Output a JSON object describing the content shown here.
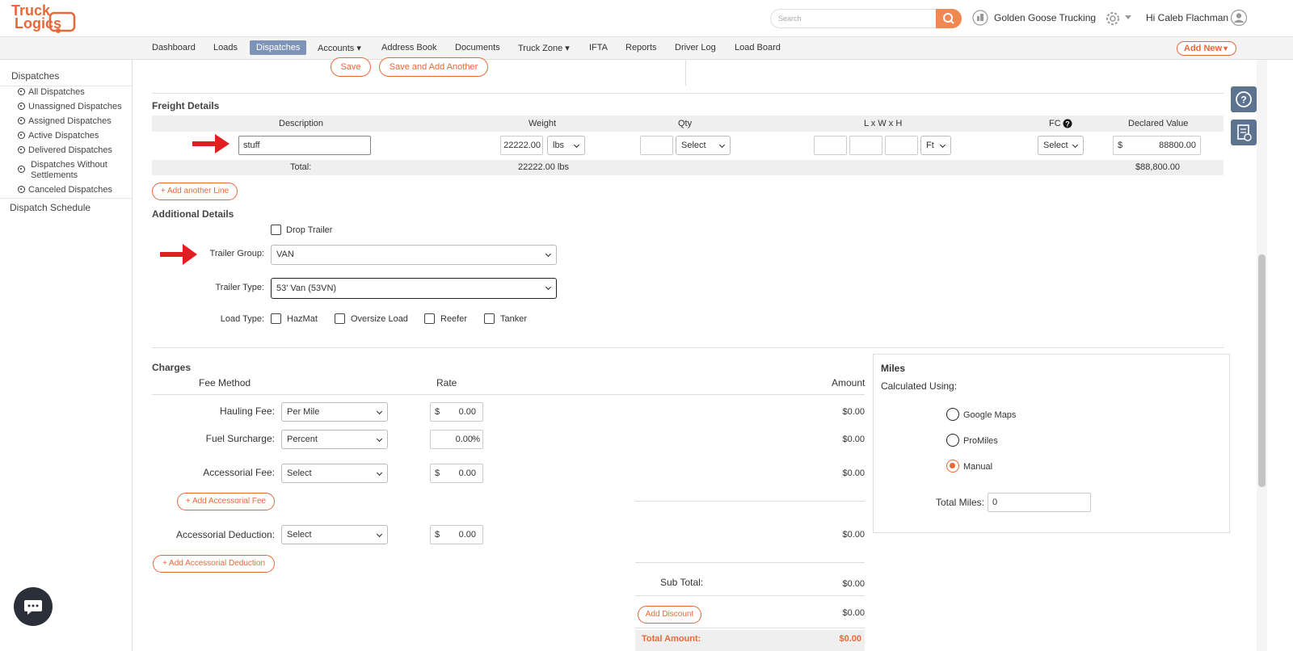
{
  "app": {
    "logo_line1": "Truck",
    "logo_line2": "Logics",
    "search_placeholder": "Search",
    "company": "Golden Goose Trucking",
    "greeting": "Hi Caleb Flachman"
  },
  "nav": {
    "items": [
      "Dashboard",
      "Loads",
      "Dispatches",
      "Accounts",
      "Address Book",
      "Documents",
      "Truck Zone",
      "IFTA",
      "Reports",
      "Driver Log",
      "Load Board"
    ],
    "add_new": "Add New"
  },
  "sidebar": {
    "title": "Dispatches",
    "items": [
      "All Dispatches",
      "Unassigned Dispatches",
      "Assigned Dispatches",
      "Active Dispatches",
      "Delivered Dispatches",
      "Dispatches Without",
      "Settlements",
      "Canceled Dispatches"
    ],
    "schedule": "Dispatch Schedule"
  },
  "top_actions": {
    "save": "Save",
    "save_add": "Save and Add Another"
  },
  "freight": {
    "title": "Freight Details",
    "headers": {
      "description": "Description",
      "weight": "Weight",
      "qty": "Qty",
      "dims": "L x W x H",
      "fc": "FC",
      "declared": "Declared Value"
    },
    "row": {
      "description": "stuff",
      "weight": "22222.00",
      "weight_unit": "lbs",
      "qty_select": "Select",
      "dim_unit": "Ft",
      "fc_select": "Select",
      "currency": "$",
      "declared": "88800.00"
    },
    "total": {
      "label": "Total:",
      "weight": "22222.00 lbs",
      "declared": "$88,800.00"
    },
    "add_line": "Add another Line"
  },
  "additional": {
    "title": "Additional Details",
    "drop_trailer": "Drop Trailer",
    "trailer_group_label": "Trailer Group:",
    "trailer_group": "VAN",
    "trailer_type_label": "Trailer Type:",
    "trailer_type": "53' Van (53VN)",
    "load_type_label": "Load Type:",
    "load_types": [
      "HazMat",
      "Oversize Load",
      "Reefer",
      "Tanker"
    ]
  },
  "charges": {
    "title": "Charges",
    "fee_method": "Fee Method",
    "rate": "Rate",
    "amount": "Amount",
    "hauling_label": "Hauling Fee:",
    "hauling_method": "Per Mile",
    "hauling_rate": "0.00",
    "hauling_amount": "$0.00",
    "fuel_label": "Fuel Surcharge:",
    "fuel_method": "Percent",
    "fuel_rate": "0.00",
    "fuel_unit": "%",
    "fuel_amount": "$0.00",
    "acc_label": "Accessorial Fee:",
    "acc_method": "Select",
    "acc_rate": "0.00",
    "acc_amount": "$0.00",
    "add_acc_fee": "Add Accessorial Fee",
    "ded_label": "Accessorial Deduction:",
    "ded_method": "Select",
    "ded_rate": "0.00",
    "ded_amount": "$0.00",
    "add_acc_ded": "Add Accessorial Deduction",
    "currency": "$",
    "subtotal_label": "Sub Total:",
    "subtotal": "$0.00",
    "add_discount": "Add Discount",
    "discount": "$0.00",
    "total_label": "Total Amount:",
    "total": "$0.00"
  },
  "miles": {
    "title": "Miles",
    "calc": "Calculated Using:",
    "options": [
      "Google Maps",
      "ProMiles",
      "Manual"
    ],
    "selected": "Manual",
    "total_label": "Total Miles:",
    "total": "0"
  },
  "colors": {
    "accent": "#e8683a",
    "nav_active": "#7d93b7",
    "arrow": "#e02020"
  }
}
